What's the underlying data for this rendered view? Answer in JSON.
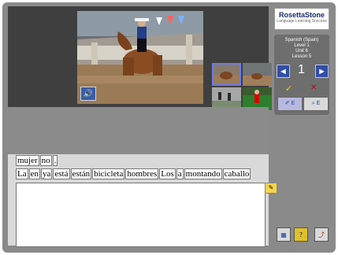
{
  "branding": {
    "logo_text": "RosettaStone",
    "logo_tagline": "Language Learning Success"
  },
  "lesson": {
    "language": "Spanish (Spain)",
    "level": "Level 1",
    "unit": "Unit 6",
    "lesson": "Lesson 5",
    "current_item": "1"
  },
  "words_row1": [
    "mujer",
    "no",
    "."
  ],
  "words_row2": [
    "La",
    "en",
    "ya",
    "está",
    "están",
    "bicicleta",
    "hombres",
    "Los",
    "a",
    "montando",
    "caballo"
  ],
  "icons": {
    "sound": "speaker-icon",
    "pencil": "pencil-icon",
    "prev": "previous-arrow-icon",
    "next": "next-arrow-icon",
    "check": "check-icon",
    "cross": "x-icon",
    "tool1": "dropper-tool-icon",
    "tool2": "magnifier-tool-icon",
    "bottom1": "menu-icon",
    "bottom2": "help-icon",
    "bottom3": "exit-icon"
  },
  "tools": {
    "tool1_label": "E",
    "tool2_label": "E"
  },
  "bottom_buttons": {
    "help_label": "?"
  },
  "colors": {
    "frame": "#8a8a8a",
    "main_bg": "#d9d9d9",
    "topbar": "#3f3f3f",
    "accent_blue": "#314ea6",
    "check": "#f1d000",
    "cross": "#d60000"
  }
}
